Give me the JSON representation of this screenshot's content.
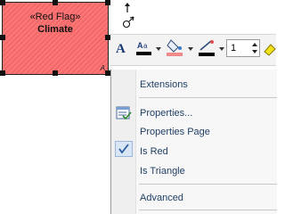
{
  "shape": {
    "stereotype": "«Red Flag»",
    "name": "Climate",
    "corner_marker": "A",
    "fill_color": "#ff6f6f"
  },
  "toolbar": {
    "font_icon": "A",
    "font_color_icon": "font-color-icon",
    "fill_color_icon": "fill-color-icon",
    "line_color_icon": "line-color-icon",
    "line_width_value": "1"
  },
  "menu": {
    "items": [
      {
        "label": "Extensions",
        "icon": ""
      },
      {
        "label": "Properties...",
        "icon": "properties-icon"
      },
      {
        "label": "Properties Page",
        "icon": ""
      },
      {
        "label": "Is Red",
        "icon": "checkmark-icon",
        "checked": true
      },
      {
        "label": "Is Triangle",
        "icon": ""
      },
      {
        "label": "Advanced",
        "icon": ""
      }
    ]
  },
  "colors": {
    "menu_text": "#1f3f66",
    "accent": "#3a78c8"
  }
}
